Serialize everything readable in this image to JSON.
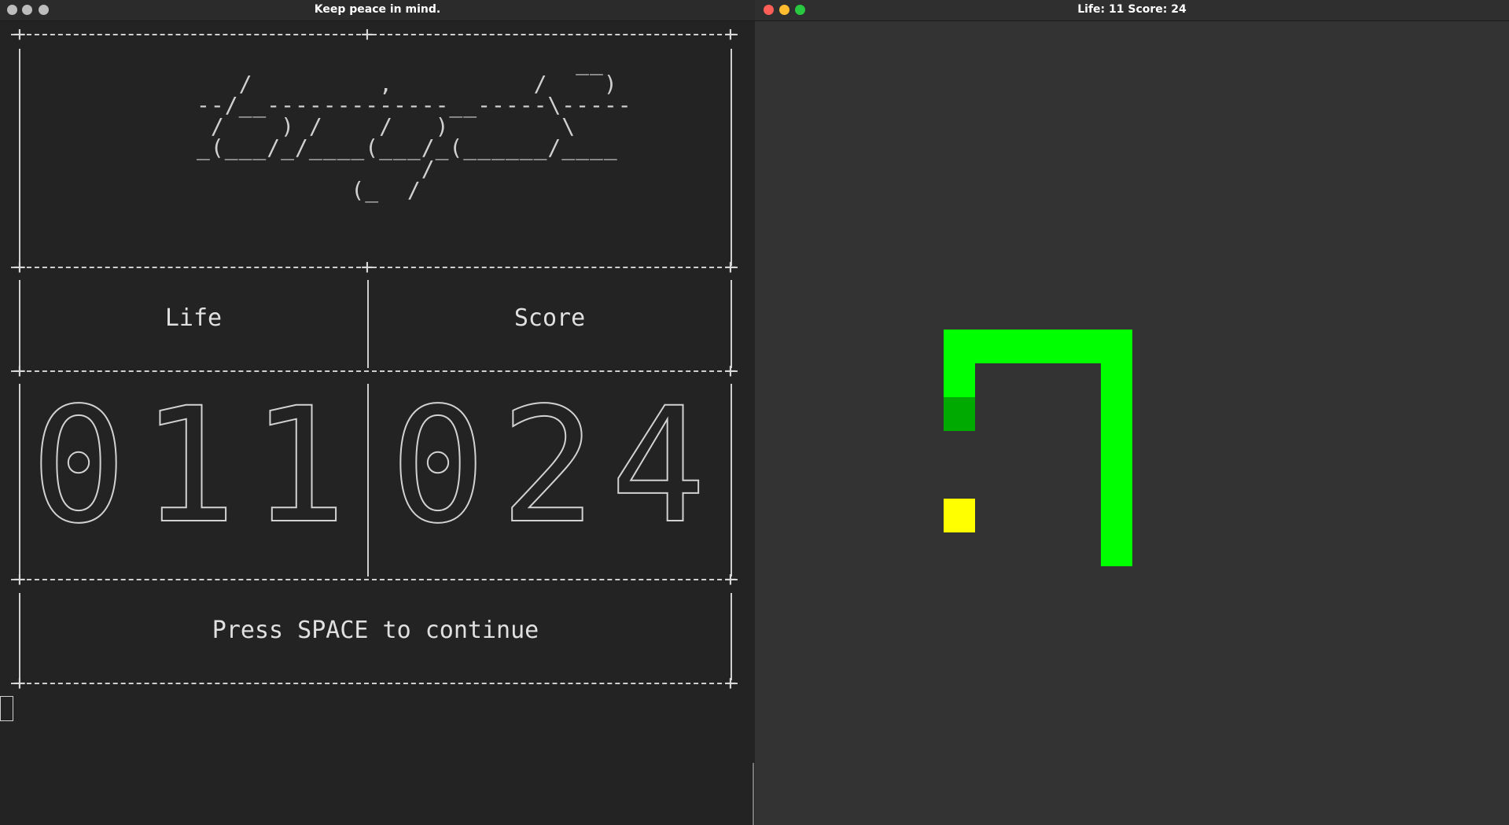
{
  "terminal": {
    "title": "Keep peace in mind.",
    "logo_ascii": "                           __\n   /         ,          /    )\n--/__-------------__-----\\-----\n /    ) /    /   )        \\\n_(___/_/____(___/_(______/____\n                /\n           (_  /",
    "life_label": "Life",
    "score_label": "Score",
    "life_value": "011",
    "score_value": "024",
    "prompt": "Press SPACE to continue"
  },
  "game": {
    "title": "Life: 11   Score: 24",
    "background_color": "#333333",
    "snake_color": "#00ff00",
    "snake_tail_color": "#00aa00",
    "food_color": "#ffff00",
    "snake_head_cell": [
      5,
      16
    ],
    "snake_tail_cell": [
      0,
      12
    ],
    "snake_cells": [
      [
        0,
        12
      ],
      [
        0,
        11
      ],
      [
        0,
        10
      ],
      [
        1,
        10
      ],
      [
        2,
        10
      ],
      [
        3,
        10
      ],
      [
        4,
        10
      ],
      [
        5,
        10
      ],
      [
        5,
        11
      ],
      [
        5,
        12
      ],
      [
        5,
        13
      ],
      [
        5,
        14
      ],
      [
        5,
        15
      ],
      [
        5,
        16
      ]
    ],
    "food_cell": [
      0,
      15
    ]
  },
  "window_buttons": {
    "terminal": [
      "#bdbdbd",
      "#bdbdbd",
      "#bdbdbd"
    ],
    "game": [
      "#ff5f57",
      "#febc2e",
      "#28c840"
    ]
  }
}
